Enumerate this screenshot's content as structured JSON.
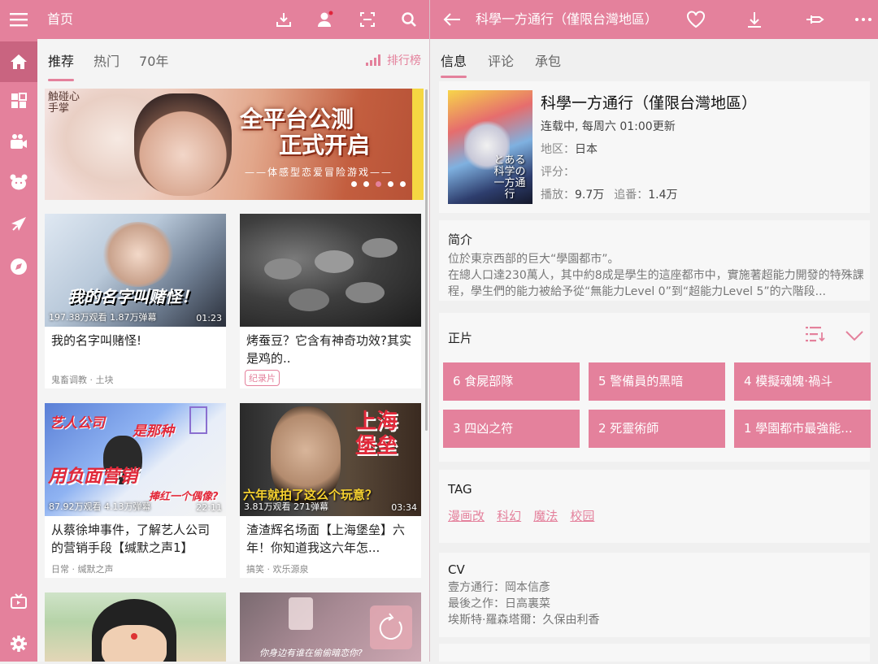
{
  "left_topbar": {
    "title": "首页",
    "icons": [
      "menu-icon",
      "download-icon",
      "user-icon",
      "scan-icon",
      "search-icon"
    ]
  },
  "right_topbar": {
    "title": "科學一方通行（僅限台灣地區）",
    "icons": [
      "back-icon",
      "heart-icon",
      "download-icon",
      "pin-icon",
      "more-icon"
    ]
  },
  "sidebar": {
    "items": [
      "home-icon",
      "category-icon",
      "camera-icon",
      "bear-icon",
      "plane-icon",
      "compass-icon",
      "tv-icon",
      "gear-icon"
    ],
    "accent": "#e4819c"
  },
  "home_tabs": [
    {
      "label": "推荐"
    },
    {
      "label": "热门"
    },
    {
      "label": "70年"
    }
  ],
  "rank_label": "排行榜",
  "banner": {
    "logo": "触碰心手掌",
    "headline_1": "全平台公测",
    "headline_2": "正式开启",
    "subline": "——体感型恋爱冒险游戏——"
  },
  "cards": [
    {
      "overlay": "我的名字叫赌怪！",
      "stats": "197.38万观看 1.87万弹幕",
      "duration": "01:23",
      "title": "我的名字叫赌怪!",
      "meta": "鬼畜调教 · 土块"
    },
    {
      "title": "烤蚕豆？它含有神奇功效?其实是鸡的..",
      "tag": "纪录片"
    },
    {
      "overlay_1": "艺人公司",
      "overlay_2": "是那种",
      "overlay_3": "用负面营销",
      "overlay_4": "捧红一个偶像?",
      "stats": "87.92万观看 4.13万弹幕",
      "duration": "22:11",
      "title": "从蔡徐坤事件，了解艺人公司的营销手段【缄默之声1】",
      "meta": "日常 · 缄默之声"
    },
    {
      "overlay_1": "上海",
      "overlay_2": "堡垒",
      "overlay_3": "六年就拍了这么个玩意？",
      "stats": "3.81万观看 271弹幕",
      "duration": "03:34",
      "title": "渣渣辉名场面【上海堡垒】六年！你知道我这六年怎...",
      "meta": "搞笑 · 欢乐源泉"
    },
    {},
    {
      "overlay": "你身边有谁在偷偷暗恋你?"
    }
  ],
  "detail_tabs": [
    {
      "label": "信息"
    },
    {
      "label": "评论"
    },
    {
      "label": "承包"
    }
  ],
  "info": {
    "title": "科學一方通行（僅限台灣地區）",
    "status": "连载中, 每周六 01:00更新",
    "region_label": "地区：",
    "region": "日本",
    "score_label": "评分：",
    "plays_label": "播放：",
    "plays": "9.7万",
    "follows_label": "追番：",
    "follows": "1.4万",
    "poster_text": "とある科学の一方通行"
  },
  "intro": {
    "heading": "简介",
    "line1": "位於東京西部的巨大“學園都市”。",
    "line2": "在總人口達230萬人，其中約8成是學生的這座都市中，實施著超能力開發的特殊課程，學生們的能力被給予從“無能力Level 0”到“超能力Level 5”的六階段..."
  },
  "episodes": {
    "heading": "正片",
    "items": [
      "6 食屍部隊",
      "5 警備員的黑暗",
      "4 模擬魂魄·禍斗",
      "3 四凶之符",
      "2 死靈術師",
      "1 學園都市最強能..."
    ]
  },
  "tags": {
    "heading": "TAG",
    "items": [
      "漫画改",
      "科幻",
      "魔法",
      "校园"
    ]
  },
  "cv": {
    "heading": "CV",
    "lines": [
      "壹方通行：岡本信彥",
      "最後之作：日高裏菜",
      "埃斯特·羅森塔爾：久保由利香"
    ]
  }
}
